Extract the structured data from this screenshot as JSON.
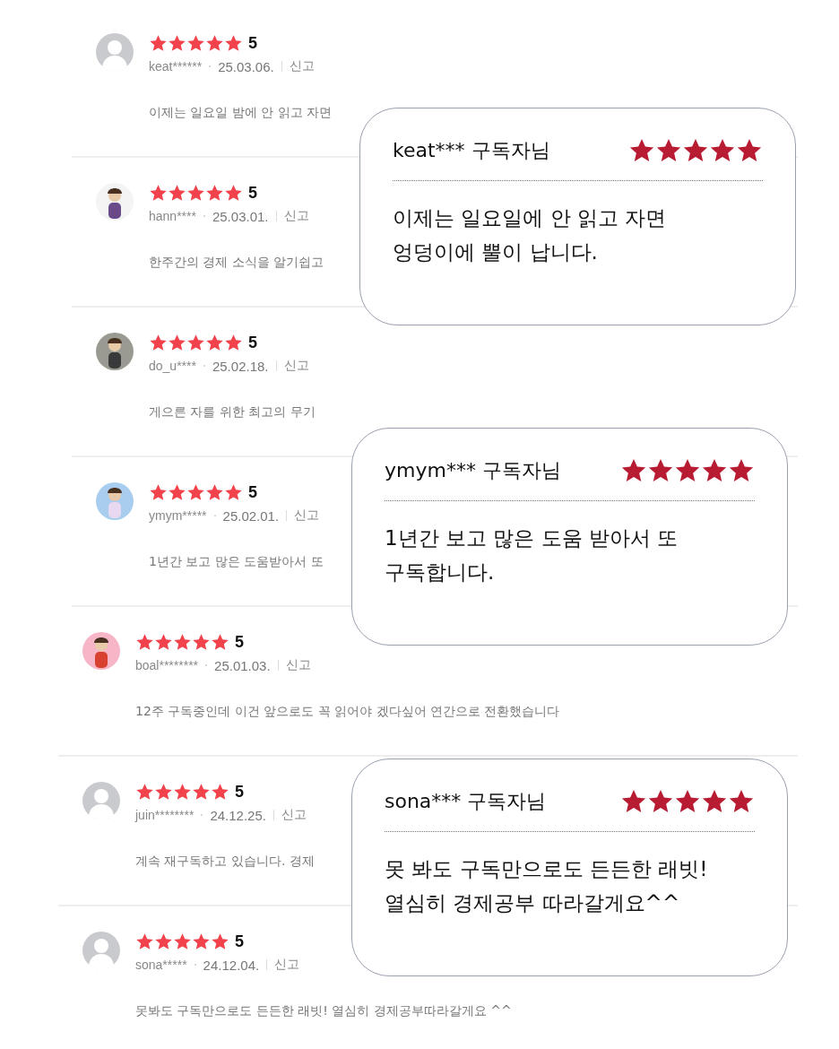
{
  "reviews": [
    {
      "avatar": {
        "kind": "default"
      },
      "stars": 5,
      "score": "5",
      "user": "keat******",
      "date": "25.03.06.",
      "report": "신고",
      "text": "이제는 일요일 밤에 안 읽고 자면"
    },
    {
      "stars": 5,
      "score": "5",
      "user": "hann****",
      "date": "25.03.01.",
      "report": "신고",
      "text": "한주간의 경제 소식을 알기쉽고"
    },
    {
      "stars": 5,
      "score": "5",
      "user": "do_u****",
      "date": "25.02.18.",
      "report": "신고",
      "text": "게으른 자를 위한 최고의 무기"
    },
    {
      "stars": 5,
      "score": "5",
      "user": "ymym*****",
      "date": "25.02.01.",
      "report": "신고",
      "text": "1년간 보고 많은 도움받아서 또"
    },
    {
      "stars": 5,
      "score": "5",
      "user": "boal********",
      "date": "25.01.03.",
      "report": "신고",
      "text": "12주 구독중인데 이건 앞으로도 꼭 읽어야 겠다싶어 연간으로 전환했습니다"
    },
    {
      "avatar": {
        "kind": "default"
      },
      "stars": 5,
      "score": "5",
      "user": "juin********",
      "date": "24.12.25.",
      "report": "신고",
      "text": "계속 재구독하고 있습니다. 경제"
    },
    {
      "avatar": {
        "kind": "default"
      },
      "stars": 5,
      "score": "5",
      "user": "sona*****",
      "date": "24.12.04.",
      "report": "신고",
      "text": "못봐도 구독만으로도 든든한 래빗! 열심히 경제공부따라갈게요 ^^"
    }
  ],
  "callouts": [
    {
      "name": "keat*** 구독자님",
      "stars": 5,
      "lines": [
        "이제는 일요일에 안 읽고 자면",
        "엉덩이에 뿔이 납니다."
      ]
    },
    {
      "name": "ymym*** 구독자님",
      "stars": 5,
      "lines": [
        "1년간 보고 많은 도움 받아서 또",
        "구독합니다."
      ]
    },
    {
      "name": "sona*** 구독자님",
      "stars": 5,
      "lines": [
        "못 봐도 구독만으로도 든든한 래빗!",
        "열심히 경제공부 따라갈게요^^"
      ]
    }
  ]
}
